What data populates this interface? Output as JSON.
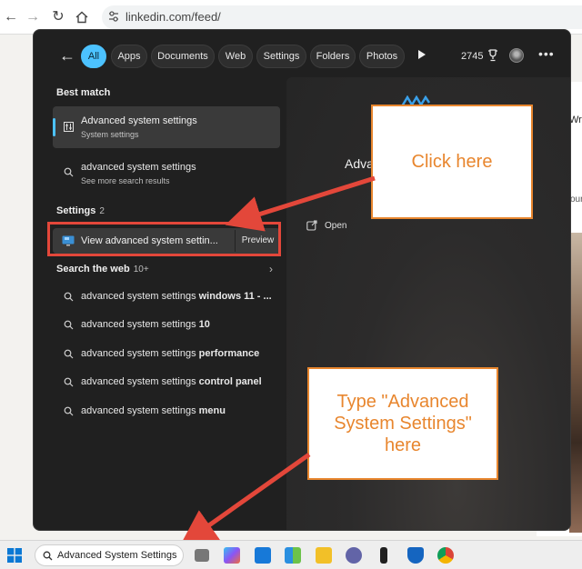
{
  "browser": {
    "url": "linkedin.com/feed/",
    "back_icon": "arrow-left-icon",
    "forward_icon": "arrow-right-icon",
    "reload_icon": "reload-icon",
    "home_icon": "home-icon"
  },
  "page_behind": {
    "snippet_1": "Wr",
    "snippet_2": "our"
  },
  "search_panel": {
    "filters": [
      "All",
      "Apps",
      "Documents",
      "Web",
      "Settings",
      "Folders",
      "Photos"
    ],
    "active_filter": "All",
    "points": "2745",
    "best_match_label": "Best match",
    "best_match": {
      "title": "Advanced system settings",
      "subtitle": "System settings"
    },
    "more_results": {
      "title": "advanced system settings",
      "subtitle": "See more search results"
    },
    "settings_label": "Settings",
    "settings_count": "2",
    "settings_item": {
      "title": "View advanced system settin...",
      "preview": "Preview"
    },
    "web_label": "Search the web",
    "web_count": "10+",
    "web_results": [
      {
        "prefix": "advanced system settings ",
        "suffix": "windows 11 - ..."
      },
      {
        "prefix": "advanced system settings ",
        "suffix": "10"
      },
      {
        "prefix": "advanced system settings ",
        "suffix": "performance"
      },
      {
        "prefix": "advanced system settings ",
        "suffix": "control panel"
      },
      {
        "prefix": "advanced system settings ",
        "suffix": "menu"
      }
    ],
    "preview_pane": {
      "title": "Adva",
      "open_label": "Open"
    }
  },
  "annotations": {
    "click_here": "Click here",
    "type_here": "Type \"Advanced System Settings\" here",
    "color_orange": "#e8862e",
    "color_red": "#e3473a"
  },
  "taskbar": {
    "search_value": "Advanced System Settings",
    "apps": [
      "file-explorer-icon",
      "copilot-icon",
      "mail-icon",
      "store-icon",
      "folder-icon",
      "teams-icon",
      "terminal-icon",
      "defender-icon",
      "chrome-icon"
    ]
  },
  "colors": {
    "accent": "#4cc2ff",
    "panel_bg": "#202020"
  }
}
